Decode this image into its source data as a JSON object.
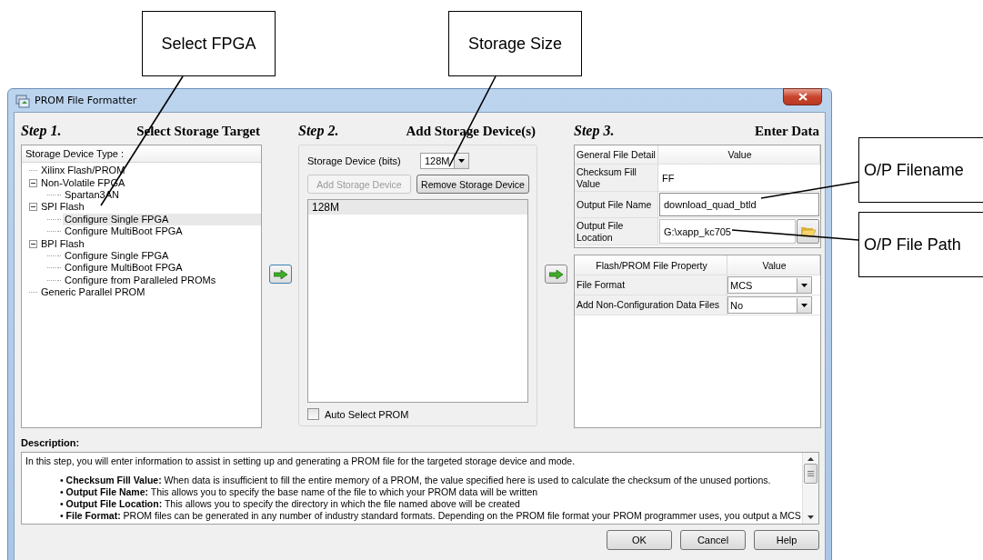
{
  "callouts": [
    {
      "text": "Select FPGA"
    },
    {
      "text": "Storage Size"
    },
    {
      "text": "O/P Filename"
    },
    {
      "text": "O/P File Path"
    }
  ],
  "window": {
    "title": "PROM File Formatter"
  },
  "step1": {
    "step_label": "Step 1.",
    "title": "Select Storage Target",
    "tree_header": "Storage Device Type :",
    "tree": [
      {
        "label": "Xilinx Flash/PROM",
        "selected": false
      },
      {
        "label": "Non-Volatile FPGA",
        "selected": false,
        "expanded": true,
        "children": [
          {
            "label": "Spartan3AN",
            "selected": false
          }
        ]
      },
      {
        "label": "SPI Flash",
        "selected": false,
        "expanded": true,
        "children": [
          {
            "label": "Configure Single FPGA",
            "selected": true
          },
          {
            "label": "Configure MultiBoot FPGA",
            "selected": false
          }
        ]
      },
      {
        "label": "BPI Flash",
        "selected": false,
        "expanded": true,
        "children": [
          {
            "label": "Configure Single FPGA",
            "selected": false
          },
          {
            "label": "Configure MultiBoot FPGA",
            "selected": false
          },
          {
            "label": "Configure from Paralleled PROMs",
            "selected": false
          }
        ]
      },
      {
        "label": "Generic Parallel PROM",
        "selected": false
      }
    ]
  },
  "step2": {
    "step_label": "Step 2.",
    "title": "Add Storage Device(s)",
    "size_label": "Storage Device (bits)",
    "size_value": "128M",
    "buttons": [
      {
        "label": "Add Storage Device",
        "disabled": true
      },
      {
        "label": "Remove Storage Device",
        "disabled": false
      }
    ],
    "devices": [
      {
        "label": "128M",
        "selected": true
      }
    ],
    "auto_select": {
      "label": "Auto Select PROM",
      "checked": false
    }
  },
  "step3": {
    "step_label": "Step 3.",
    "title": "Enter Data",
    "general": {
      "columns": [
        "General File Detail",
        "Value"
      ],
      "rows": [
        {
          "kind": "text",
          "label": "Checksum Fill Value",
          "value": "FF"
        },
        {
          "kind": "input",
          "label": "Output File Name",
          "value": "download_quad_btld"
        },
        {
          "kind": "browse",
          "label": "Output File Location",
          "value": "G:\\xapp_kc705"
        }
      ]
    },
    "properties": {
      "columns": [
        "Flash/PROM File Property",
        "Value"
      ],
      "rows": [
        {
          "label": "File Format",
          "value": "MCS"
        },
        {
          "label": "Add Non-Configuration Data Files",
          "value": "No"
        }
      ]
    }
  },
  "description": {
    "label": "Description:",
    "intro": "In this step, you will enter information to assist in setting up and generating a PROM file for the targeted storage device and mode.",
    "bullets": [
      "• **Checksum Fill Value:** When data is insufficient to fill the entire memory of a PROM, the value specified here is used to calculate the checksum of the unused portions.",
      "• **Output File Name:** This allows you to specify the base name of the file to which your PROM data will be written",
      "• **Output File Location:** This allows you to specify the directory in which the file named above will be created",
      "• **File Format:** PROM files can be generated in any number of industry standard formats. Depending on the PROM file format your PROM programmer uses, you output a MCS"
    ]
  },
  "buttons": [
    "OK",
    "Cancel",
    "Help"
  ]
}
